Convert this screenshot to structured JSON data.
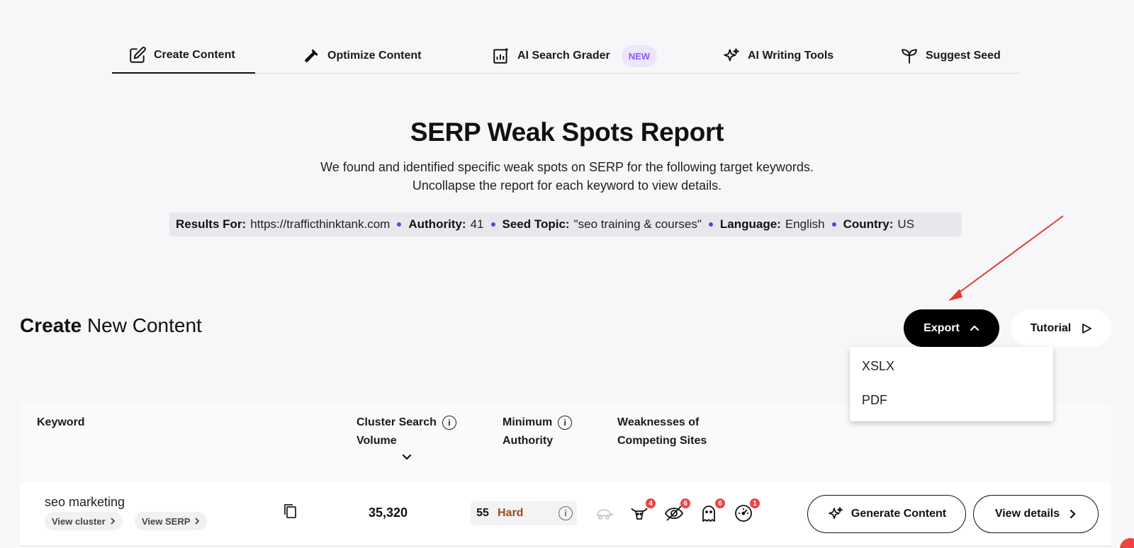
{
  "tabs": [
    {
      "label": "Create Content",
      "icon": "edit-icon"
    },
    {
      "label": "Optimize Content",
      "icon": "hammer-icon"
    },
    {
      "label": "AI Search Grader",
      "icon": "chart-icon",
      "badge": "NEW"
    },
    {
      "label": "AI Writing Tools",
      "icon": "sparkles-icon"
    },
    {
      "label": "Suggest Seed",
      "icon": "sprout-icon"
    }
  ],
  "report": {
    "title": "SERP Weak Spots Report",
    "subtitle": "We found and identified specific weak spots on SERP for the following target keywords. Uncollapse the report for each keyword to view details.",
    "results_label": "Results For:",
    "results_value": "https://trafficthinktank.com",
    "authority_label": "Authority:",
    "authority_value": "41",
    "seed_label": "Seed Topic:",
    "seed_value": "\"seo training & courses\"",
    "language_label": "Language:",
    "language_value": "English",
    "country_label": "Country:",
    "country_value": "US"
  },
  "section": {
    "title_bold": "Create",
    "title_rest": " New Content",
    "export_label": "Export",
    "tutorial_label": "Tutorial"
  },
  "export_menu": [
    "XSLX",
    "PDF"
  ],
  "table": {
    "headers": {
      "keyword": "Keyword",
      "volume_line1": "Cluster Search",
      "volume_line2": "Volume",
      "authority_line1": "Minimum",
      "authority_line2": "Authority",
      "weak_line1": "Weaknesses of",
      "weak_line2": "Competing Sites"
    },
    "rows": [
      {
        "keyword": "seo marketing",
        "view_cluster": "View cluster",
        "view_serp": "View SERP",
        "volume": "35,320",
        "min_authority": "55",
        "difficulty": "Hard",
        "weakness_counts": [
          "4",
          "6",
          "6",
          "1"
        ],
        "generate_label": "Generate Content",
        "details_label": "View details"
      }
    ]
  },
  "colors": {
    "accent": "#000000",
    "badge_bg": "#ece6fd",
    "badge_text": "#8b5cf6",
    "hard": "#9a4b1c",
    "count_badge": "#ef4444",
    "arrow": "#e53935"
  }
}
